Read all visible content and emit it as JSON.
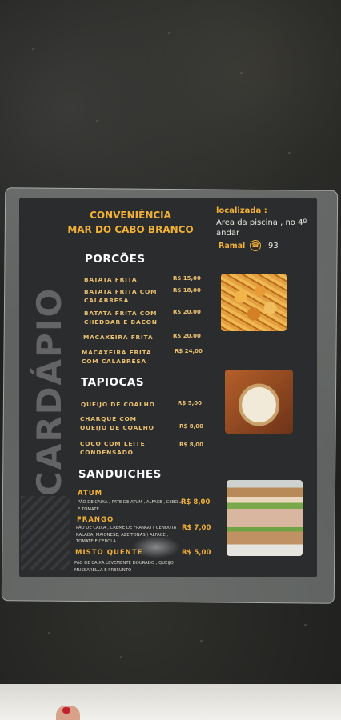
{
  "menu": {
    "title_line1": "CONVENIÊNCIA",
    "title_line2": "MAR DO CABO BRANCO",
    "side_word": "CARDÁPIO",
    "location": {
      "label": "localizada :",
      "text": "Área da piscina , no 4º andar",
      "ramal_label": "Ramal",
      "phone_icon": "phone-icon",
      "ramal_number": "93"
    },
    "porcoes": {
      "heading": "PORCÕES",
      "items": [
        {
          "name": "BATATA FRITA",
          "price": "R$ 15,00"
        },
        {
          "name": "BATATA FRITA COM CALABRESA",
          "price": "R$ 18,00"
        },
        {
          "name": "BATATA FRITA COM CHEDDAR E BACON",
          "price": "R$ 20,00"
        },
        {
          "name": "MACAXEIRA FRITA",
          "price": "R$ 20,00"
        },
        {
          "name": "MACAXEIRA FRITA COM CALABRESA",
          "price": "R$ 24,00"
        }
      ]
    },
    "tapiocas": {
      "heading": "TAPIOCAS",
      "items": [
        {
          "name": "QUEIJO DE COALHO",
          "price": "R$ 5,00"
        },
        {
          "name": "CHARQUE COM QUEIJO DE COALHO",
          "price": "R$ 8,00"
        },
        {
          "name": "COCO COM LEITE CONDENSADO",
          "price": "R$ 8,00"
        }
      ]
    },
    "sanduiches": {
      "heading": "SANDUICHES",
      "items": [
        {
          "name": "ATUM",
          "desc": "PÃO DE CAIXA , PATE DE ATUM , ALFACE , CEBOLA E TOMATE .",
          "price": "R$ 8,00"
        },
        {
          "name": "FRANGO",
          "desc": "PÃO DE CAIXA , CREME DE FRANGO ( CENOUTA RALADA, MAIONESE, AZEITONAS ) ALFACE , TOMATE E CEBOLA .",
          "price": "R$ 7,00"
        },
        {
          "name": "MISTO QUENTE",
          "desc": "PÃO DE CAIXA LEVEMENTE DOURADO , QUEIJO MUSSARELLA E PRESUNTO",
          "price": "R$ 5,00"
        }
      ]
    }
  }
}
